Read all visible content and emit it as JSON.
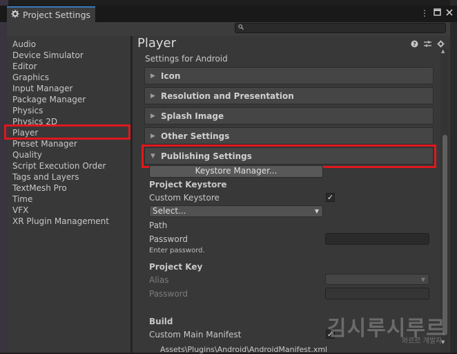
{
  "window": {
    "title": "Project Settings",
    "search_placeholder": ""
  },
  "sidebar": {
    "items": [
      {
        "label": "Audio"
      },
      {
        "label": "Device Simulator"
      },
      {
        "label": "Editor"
      },
      {
        "label": "Graphics"
      },
      {
        "label": "Input Manager"
      },
      {
        "label": "Package Manager"
      },
      {
        "label": "Physics"
      },
      {
        "label": "Physics 2D"
      },
      {
        "label": "Player",
        "selected": true
      },
      {
        "label": "Preset Manager"
      },
      {
        "label": "Quality"
      },
      {
        "label": "Script Execution Order"
      },
      {
        "label": "Tags and Layers"
      },
      {
        "label": "TextMesh Pro"
      },
      {
        "label": "Time"
      },
      {
        "label": "VFX"
      },
      {
        "label": "XR Plugin Management"
      }
    ]
  },
  "main": {
    "title": "Player",
    "subtitle": "Settings for Android",
    "sections": [
      {
        "label": "Icon",
        "expanded": false
      },
      {
        "label": "Resolution and Presentation",
        "expanded": false
      },
      {
        "label": "Splash Image",
        "expanded": false
      },
      {
        "label": "Other Settings",
        "expanded": false
      },
      {
        "label": "Publishing Settings",
        "expanded": true
      }
    ],
    "publishing": {
      "keystore_button": "Keystore Manager...",
      "project_keystore_header": "Project Keystore",
      "custom_keystore_label": "Custom Keystore",
      "custom_keystore_checked": true,
      "select_dropdown": "Select...",
      "path_label": "Path",
      "password_label": "Password",
      "enter_password_hint": "Enter password.",
      "project_key_header": "Project Key",
      "alias_label": "Alias",
      "key_password_label": "Password",
      "build_header": "Build",
      "custom_main_manifest_label": "Custom Main Manifest",
      "custom_main_manifest_checked": true,
      "manifest_path": "Assets\\Plugins\\Android\\AndroidManifest.xml"
    }
  },
  "watermark": {
    "main": "김시루시루르",
    "sub": "와르르 개발자"
  },
  "colors": {
    "highlight": "#e0171d",
    "accent_tab": "#3a79bb"
  },
  "icons": {
    "settings": "gear-icon",
    "help": "help-icon",
    "presets": "sliders-icon",
    "menu": "kebab-menu-icon"
  }
}
